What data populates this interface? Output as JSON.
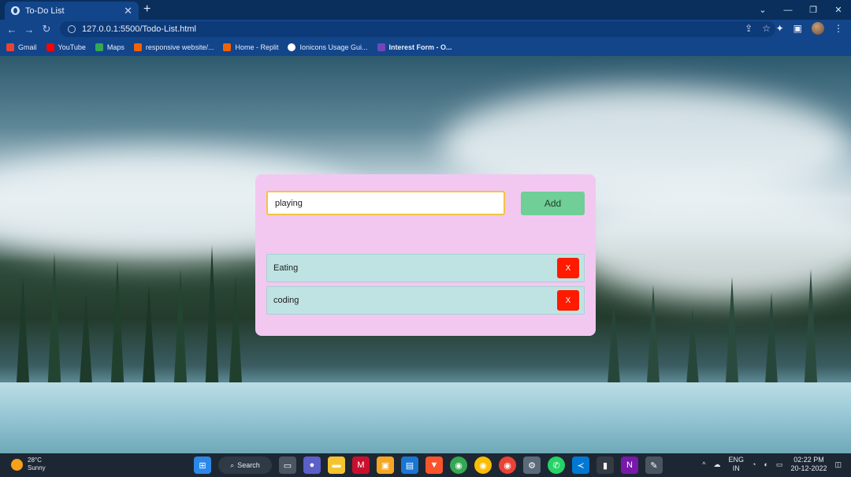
{
  "browser": {
    "tab_title": "To-Do List",
    "tab_close": "✕",
    "new_tab": "+",
    "url": "127.0.0.1:5500/Todo-List.html",
    "window_controls": [
      "⌄",
      "—",
      "❐",
      "✕"
    ],
    "bookmarks": [
      {
        "label": "Gmail",
        "icon": "gmail-icon",
        "color": "#ea4335"
      },
      {
        "label": "YouTube",
        "icon": "youtube-icon",
        "color": "#ff0000"
      },
      {
        "label": "Maps",
        "icon": "maps-icon",
        "color": "#34a853"
      },
      {
        "label": "responsive website/...",
        "icon": "replit-icon",
        "color": "#f26207"
      },
      {
        "label": "Home - Replit",
        "icon": "replit-icon",
        "color": "#f26207"
      },
      {
        "label": "Ionicons Usage Gui...",
        "icon": "ionicons-icon",
        "color": "#ffffff"
      },
      {
        "label": "Interest Form - O...",
        "icon": "forms-icon",
        "color": "#7248b9"
      }
    ]
  },
  "todo": {
    "input_value": "playing",
    "add_label": "Add",
    "delete_label": "X",
    "tasks": [
      "Eating",
      "coding"
    ],
    "colors": {
      "card": "#f2c8f0",
      "add": "#6fcf97",
      "delete": "#ff1a00",
      "task": "#bfe3e3",
      "input_border": "#f6c344"
    }
  },
  "taskbar": {
    "temperature": "28°C",
    "condition": "Sunny",
    "search_label": "Search",
    "language_top": "ENG",
    "language_bottom": "IN",
    "time": "02:22 PM",
    "date": "20-12-2022"
  }
}
